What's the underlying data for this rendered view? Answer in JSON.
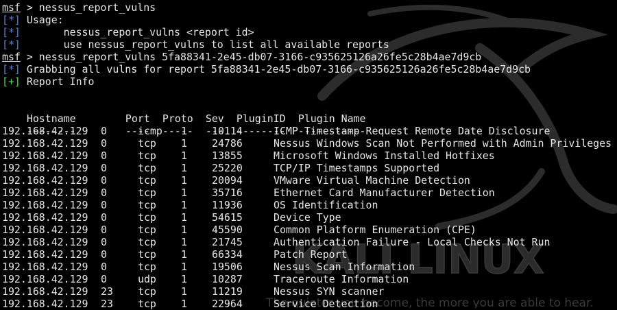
{
  "terminal": {
    "prompt": "msf",
    "tags": {
      "info": "[*]",
      "good": "[+]"
    },
    "line1_cmd": " > nessus_report_vulns",
    "line2_text": " Usage:",
    "line3_text": "       nessus_report_vulns <report id>",
    "line4_text": "       use nessus_report_vulns to list all available reports",
    "line5_cmd": " > nessus_report_vulns 5fa88341-2e45-db07-3166-c935625126a26fe5c28b4ae7d9cb",
    "line6_text": " Grabbing all vulns for report 5fa88341-2e45-db07-3166-c935625126a26fe5c28b4ae7d9cb",
    "line7_text": " Report Info"
  },
  "table": {
    "headers": [
      "Hostname",
      "Port",
      "Proto",
      "Sev",
      "PluginID",
      "Plugin Name"
    ],
    "underlines": [
      "--------",
      "----",
      "-----",
      "---",
      "--------",
      "-----------"
    ],
    "rows": [
      [
        "192.168.42.129",
        "0",
        "icmp",
        "1",
        "10114",
        "ICMP Timestamp Request Remote Date Disclosure"
      ],
      [
        "192.168.42.129",
        "0",
        "tcp",
        "1",
        "24786",
        "Nessus Windows Scan Not Performed with Admin Privileges"
      ],
      [
        "192.168.42.129",
        "0",
        "tcp",
        "1",
        "13855",
        "Microsoft Windows Installed Hotfixes"
      ],
      [
        "192.168.42.129",
        "0",
        "tcp",
        "1",
        "25220",
        "TCP/IP Timestamps Supported"
      ],
      [
        "192.168.42.129",
        "0",
        "tcp",
        "1",
        "20094",
        "VMware Virtual Machine Detection"
      ],
      [
        "192.168.42.129",
        "0",
        "tcp",
        "1",
        "35716",
        "Ethernet Card Manufacturer Detection"
      ],
      [
        "192.168.42.129",
        "0",
        "tcp",
        "1",
        "11936",
        "OS Identification"
      ],
      [
        "192.168.42.129",
        "0",
        "tcp",
        "1",
        "54615",
        "Device Type"
      ],
      [
        "192.168.42.129",
        "0",
        "tcp",
        "1",
        "45590",
        "Common Platform Enumeration (CPE)"
      ],
      [
        "192.168.42.129",
        "0",
        "tcp",
        "1",
        "21745",
        "Authentication Failure - Local Checks Not Run"
      ],
      [
        "192.168.42.129",
        "0",
        "tcp",
        "1",
        "66334",
        "Patch Report"
      ],
      [
        "192.168.42.129",
        "0",
        "tcp",
        "1",
        "19506",
        "Nessus Scan Information"
      ],
      [
        "192.168.42.129",
        "0",
        "udp",
        "1",
        "10287",
        "Traceroute Information"
      ],
      [
        "192.168.42.129",
        "23",
        "tcp",
        "1",
        "11219",
        "Nessus SYN scanner"
      ],
      [
        "192.168.42.129",
        "23",
        "tcp",
        "1",
        "22964",
        "Service Detection"
      ]
    ]
  },
  "wallpaper": {
    "logo_text": "KALI LINUX",
    "tagline": "The quieter you become, the more you are able to hear.",
    "dragon_icon": "kali-dragon-icon"
  },
  "colors": {
    "background": "#000000",
    "text": "#e6e6e6",
    "info_tag": "#5b7bd8",
    "good_tag": "#52d152",
    "watermark": "#2e2e2e"
  }
}
